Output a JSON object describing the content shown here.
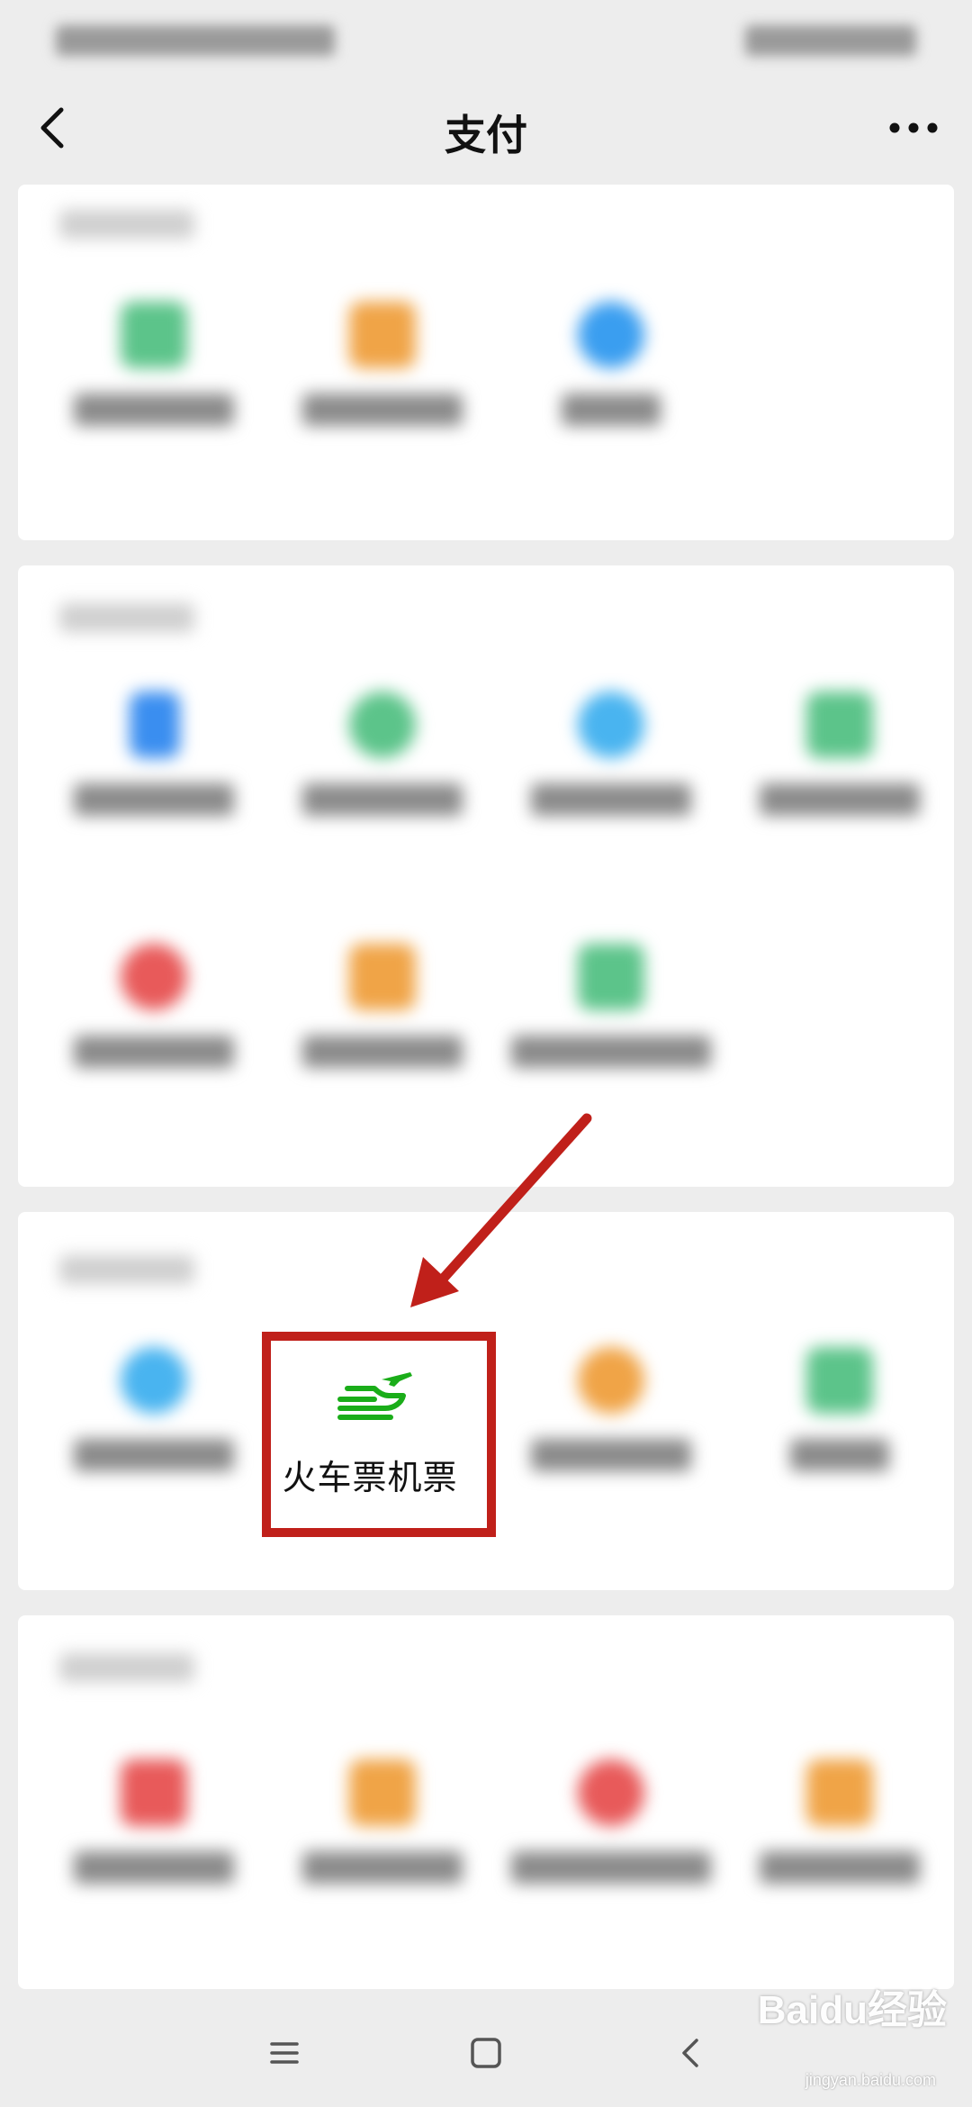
{
  "nav": {
    "title": "支付"
  },
  "focused_service": {
    "label": "火车票机票",
    "icon": "train-plane-icon"
  },
  "watermark": {
    "brand": "Baidu经验",
    "url": "jingyan.baidu.com"
  },
  "colors": {
    "highlight": "#c0201a",
    "accent_green": "#1aad19",
    "annotation_arrow": "#c0201a"
  }
}
